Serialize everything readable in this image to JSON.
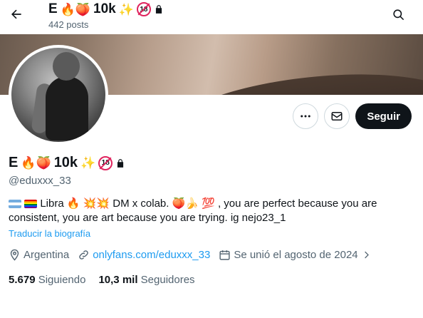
{
  "header": {
    "name": "E",
    "emojis_before": "🔥🍑",
    "followers_tag": "10k",
    "emojis_after": "✨",
    "age_badge": "18",
    "posts_count": "442 posts",
    "icons": [
      "back-arrow-icon",
      "search-icon",
      "lock-icon"
    ]
  },
  "profile": {
    "name": "E",
    "emojis_before": "🔥🍑",
    "followers_tag": "10k",
    "emojis_after": "✨",
    "age_badge": "18",
    "handle": "@eduxxx_33",
    "bio_line1": "Libra 🔥 💥💥 DM x colab. 🍑🍌 💯 , you are perfect because you are",
    "bio_line2": "consistent, you are art because you are trying. ig nejo23_1",
    "translate_label": "Traducir la biografía",
    "location": "Argentina",
    "link": "onlyfans.com/eduxxx_33",
    "joined": "Se unió el agosto de 2024"
  },
  "actions": {
    "more_icon": "more-icon",
    "message_icon": "mail-icon",
    "follow_label": "Seguir"
  },
  "stats": {
    "following_count": "5.679",
    "following_label": "Siguiendo",
    "followers_count": "10,3 mil",
    "followers_label": "Seguidores"
  },
  "colors": {
    "primary_text": "#0f1419",
    "secondary_text": "#536471",
    "link": "#1d9bf0",
    "follow_button_bg": "#0f1419"
  }
}
